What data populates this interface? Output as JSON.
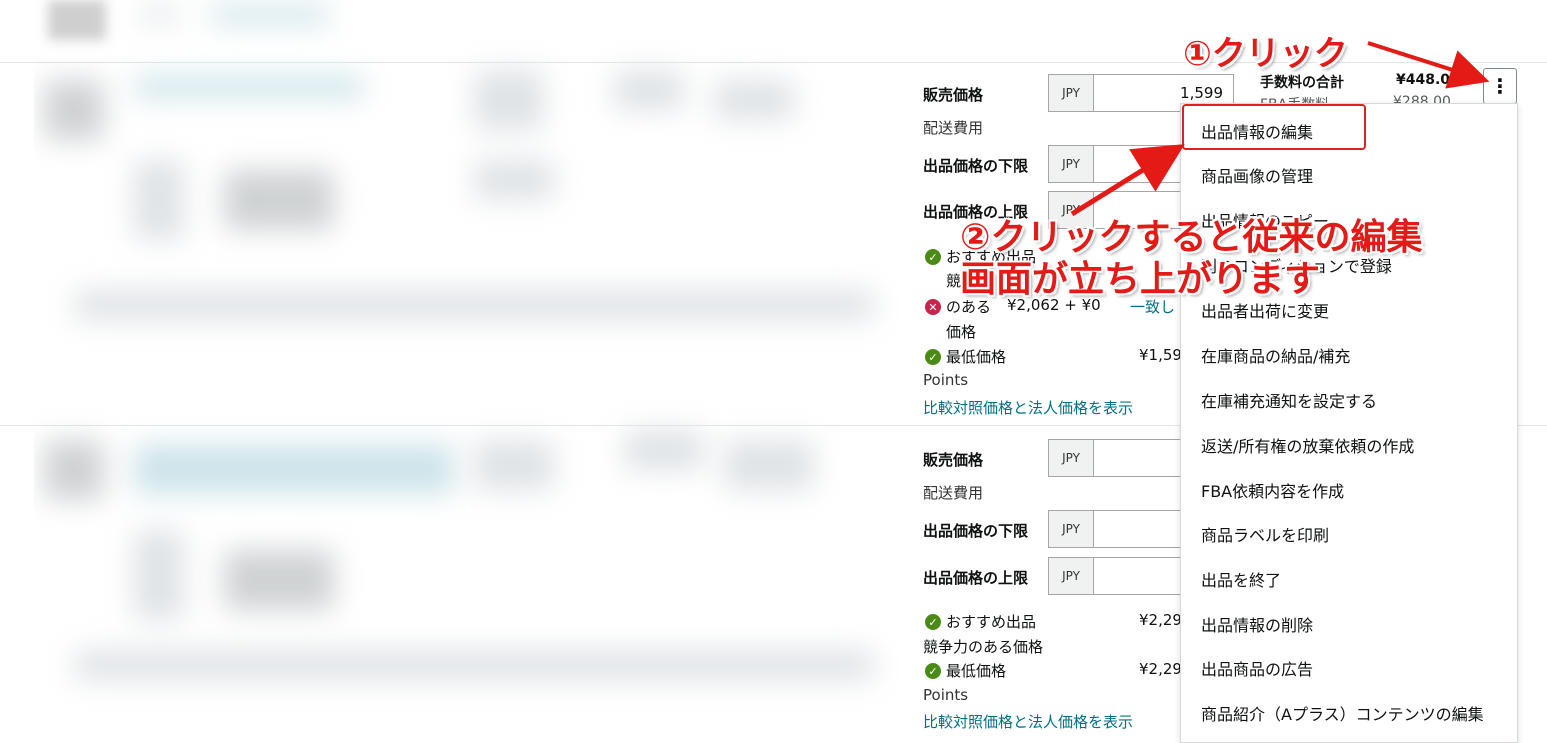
{
  "listing1": {
    "sale_price_label": "販売価格",
    "currency": "JPY",
    "sale_price_value": "1,599",
    "shipping_label": "配送費用",
    "min_price_label": "出品価格の下限",
    "max_price_label": "出品価格の上限",
    "fee_total_label": "手数料の合計",
    "fee_total_value": "¥448.00",
    "fba_fee_label": "FBA手数料",
    "fba_fee_value": "¥288.00",
    "recommend_line1": "おすすめ出品",
    "recommend_line2": "競",
    "competitive_prefix": "のある",
    "competitive_value": "¥2,062 + ¥0",
    "competitive_note": "一致し",
    "competitive_line2": "価格",
    "lowest_label": "最低価格",
    "lowest_value": "¥1,59",
    "points_label": "Points",
    "compare_link": "比較対照価格と法人価格を表示"
  },
  "listing2": {
    "sale_price_label": "販売価格",
    "currency": "JPY",
    "shipping_label": "配送費用",
    "min_price_label": "出品価格の下限",
    "max_price_label": "出品価格の上限",
    "recommend_label": "おすすめ出品",
    "recommend_value": "¥2,29",
    "competitive_label": "競争力のある価格",
    "lowest_label": "最低価格",
    "lowest_value": "¥2,29",
    "points_label": "Points",
    "compare_link": "比較対照価格と法人価格を表示"
  },
  "menu": {
    "items": [
      "出品情報の編集",
      "商品画像の管理",
      "出品情報のコピー",
      "別のコンディションで登録",
      "出品者出荷に変更",
      "在庫商品の納品/補充",
      "在庫補充通知を設定する",
      "返送/所有権の放棄依頼の作成",
      "FBA依頼内容を作成",
      "商品ラベルを印刷",
      "出品を終了",
      "出品情報の削除",
      "出品商品の広告",
      "商品紹介（Aプラス）コンテンツの編集"
    ]
  },
  "annotations": {
    "step1": "①クリック",
    "step2_line1": "②クリックすると従来の編集",
    "step2_line2": "画面が立ち上がります"
  },
  "colors": {
    "annotation_red": "#e41a17",
    "link_teal": "#007185",
    "ok_green": "#4c8a17",
    "error_red": "#c7254e"
  },
  "icons": [
    "kebab-menu-icon",
    "check-circle-icon",
    "x-circle-icon"
  ]
}
